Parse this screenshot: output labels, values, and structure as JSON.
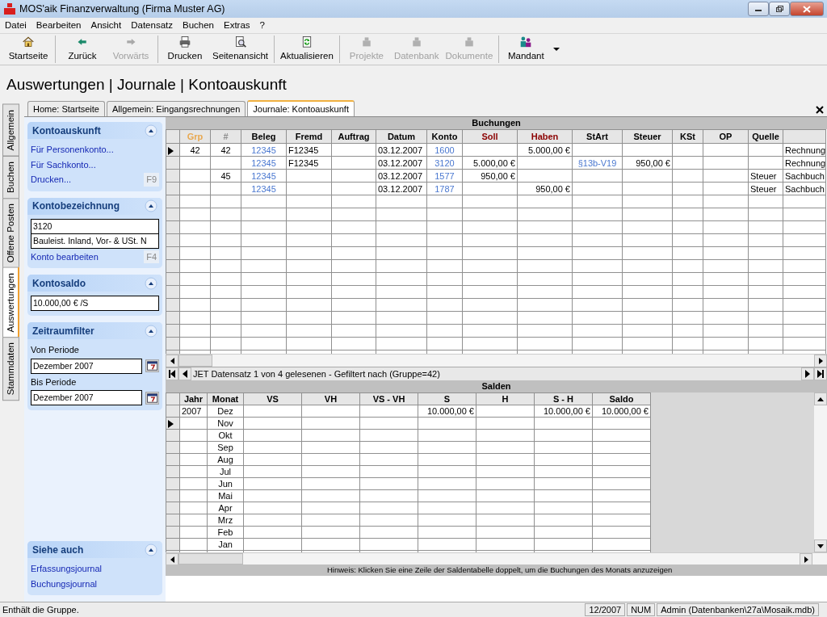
{
  "window": {
    "title": "MOS'aik Finanzverwaltung (Firma Muster AG)"
  },
  "menu": [
    "Datei",
    "Bearbeiten",
    "Ansicht",
    "Datensatz",
    "Buchen",
    "Extras",
    "?"
  ],
  "toolbar": {
    "groups": [
      [
        {
          "label": "Startseite",
          "disabled": false
        }
      ],
      [
        {
          "label": "Zurück",
          "disabled": false
        },
        {
          "label": "Vorwärts",
          "disabled": true
        }
      ],
      [
        {
          "label": "Drucken",
          "disabled": false
        },
        {
          "label": "Seitenansicht",
          "disabled": false
        }
      ],
      [
        {
          "label": "Aktualisieren",
          "disabled": false
        }
      ],
      [
        {
          "label": "Projekte",
          "disabled": true
        },
        {
          "label": "Datenbank",
          "disabled": true
        },
        {
          "label": "Dokumente",
          "disabled": true
        }
      ],
      [
        {
          "label": "Mandant",
          "disabled": false
        }
      ]
    ]
  },
  "heading": "Auswertungen | Journale | Kontoauskunft",
  "side_tabs": [
    {
      "label": "Allgemein",
      "selected": false
    },
    {
      "label": "Buchen",
      "selected": false
    },
    {
      "label": "Offene Posten",
      "selected": false
    },
    {
      "label": "Auswertungen",
      "selected": true
    },
    {
      "label": "Stammdaten",
      "selected": false
    }
  ],
  "tabs": [
    {
      "label": "Home: Startseite",
      "selected": false
    },
    {
      "label": "Allgemein: Eingangsrechnungen",
      "selected": false
    },
    {
      "label": "Journale: Kontoauskunft",
      "selected": true
    }
  ],
  "sidebar": {
    "panels": [
      {
        "title": "Kontoauskunft",
        "expanded": true,
        "items": [
          {
            "kind": "link",
            "label": "Für Personenkonto..."
          },
          {
            "kind": "link",
            "label": "Für Sachkonto..."
          },
          {
            "kind": "link",
            "label": "Drucken...",
            "shortcut": "F9"
          }
        ]
      },
      {
        "title": "Kontobezeichnung",
        "expanded": true,
        "items": [
          {
            "kind": "field",
            "value": "3120"
          },
          {
            "kind": "field",
            "value": "Bauleist. Inland, Vor- & USt. N"
          },
          {
            "kind": "link",
            "label": "Konto bearbeiten",
            "shortcut": "F4"
          }
        ]
      },
      {
        "title": "Kontosaldo",
        "expanded": true,
        "items": [
          {
            "kind": "field",
            "value": "10.000,00 € /S"
          }
        ]
      },
      {
        "title": "Zeitraumfilter",
        "expanded": true,
        "items": [
          {
            "kind": "label",
            "label": "Von Periode"
          },
          {
            "kind": "date",
            "value": "Dezember 2007"
          },
          {
            "kind": "label",
            "label": "Bis Periode"
          },
          {
            "kind": "date",
            "value": "Dezember 2007"
          }
        ]
      }
    ],
    "see_also": {
      "title": "Siehe auch",
      "expanded": true,
      "items": [
        {
          "kind": "link",
          "label": "Erfassungsjournal"
        },
        {
          "kind": "link",
          "label": "Buchungsjournal"
        }
      ]
    }
  },
  "buchungen": {
    "title": "Buchungen",
    "columns": [
      {
        "label": "Grp",
        "kind": "center",
        "color": "#e8a850"
      },
      {
        "label": "#",
        "kind": "center",
        "color": "#909090"
      },
      {
        "label": "Beleg",
        "kind": "link"
      },
      {
        "label": "Fremd",
        "kind": "text"
      },
      {
        "label": "Auftrag",
        "kind": "text"
      },
      {
        "label": "Datum",
        "kind": "text"
      },
      {
        "label": "Konto",
        "kind": "link"
      },
      {
        "label": "Soll",
        "kind": "amount",
        "color": "#8b0000"
      },
      {
        "label": "Haben",
        "kind": "amount",
        "color": "#8b0000"
      },
      {
        "label": "StArt",
        "kind": "link"
      },
      {
        "label": "Steuer",
        "kind": "amount"
      },
      {
        "label": "KSt",
        "kind": "text"
      },
      {
        "label": "OP",
        "kind": "text"
      },
      {
        "label": "Quelle",
        "kind": "text"
      },
      {
        "kind": "text"
      }
    ],
    "rows": [
      {
        "selected": true,
        "grp": "42",
        "nr": "42",
        "beleg": "12345",
        "fremd": "F12345",
        "datum": "03.12.2007",
        "konto": "1600",
        "haben": "5.000,00 €",
        "column_16": "Rechnung"
      },
      {
        "selected": false,
        "beleg": "12345",
        "fremd": "F12345",
        "datum": "03.12.2007",
        "konto": "3120",
        "soll": "5.000,00 €",
        "start": "§13b-V19",
        "steuer": "950,00 €",
        "column_16": "Rechnung"
      },
      {
        "selected": false,
        "nr": "45",
        "beleg": "12345",
        "datum": "03.12.2007",
        "konto": "1577",
        "soll": "950,00 €",
        "quelle": "Steuer",
        "column_16": "Sachbuch"
      },
      {
        "selected": false,
        "beleg": "12345",
        "datum": "03.12.2007",
        "konto": "1787",
        "haben": "950,00 €",
        "quelle": "Steuer",
        "column_16": "Sachbuch"
      }
    ],
    "navigator": "JET Datensatz 1 von 4 gelesenen - Gefiltert nach (Gruppe=42)"
  },
  "salden": {
    "title": "Salden",
    "columns": [
      {
        "label": "Jahr",
        "kind": "text"
      },
      {
        "label": "Monat",
        "kind": "center"
      },
      {
        "label": "VS",
        "kind": "amount"
      },
      {
        "label": "VH",
        "kind": "amount"
      },
      {
        "label": "VS - VH",
        "kind": "amount"
      },
      {
        "label": "S",
        "kind": "amount"
      },
      {
        "label": "H",
        "kind": "amount"
      },
      {
        "label": "S - H",
        "kind": "amount"
      },
      {
        "label": "Saldo",
        "kind": "amount"
      }
    ],
    "rows": [
      {
        "selected": false,
        "jahr": "2007",
        "monat": "Dez",
        "s": "10.000,00 €",
        "sh": "10.000,00 €",
        "saldo": "10.000,00 €"
      },
      {
        "selected": true,
        "monat": "Nov"
      },
      {
        "selected": false,
        "monat": "Okt"
      },
      {
        "selected": false,
        "monat": "Sep"
      },
      {
        "selected": false,
        "monat": "Aug"
      },
      {
        "selected": false,
        "monat": "Jul"
      },
      {
        "selected": false,
        "monat": "Jun"
      },
      {
        "selected": false,
        "monat": "Mai"
      },
      {
        "selected": false,
        "monat": "Apr"
      },
      {
        "selected": false,
        "monat": "Mrz"
      },
      {
        "selected": false,
        "monat": "Feb"
      },
      {
        "selected": false,
        "monat": "Jan"
      }
    ],
    "hint": "Hinweis: Klicken Sie eine Zeile der Saldentabelle doppelt, um die Buchungen des Monats anzuzeigen"
  },
  "status_bar": {
    "message": "Enthält die Gruppe.",
    "panels": [
      "12/2007",
      "NUM",
      "Admin (Datenbanken\\27a\\Mosaik.mdb)"
    ]
  }
}
